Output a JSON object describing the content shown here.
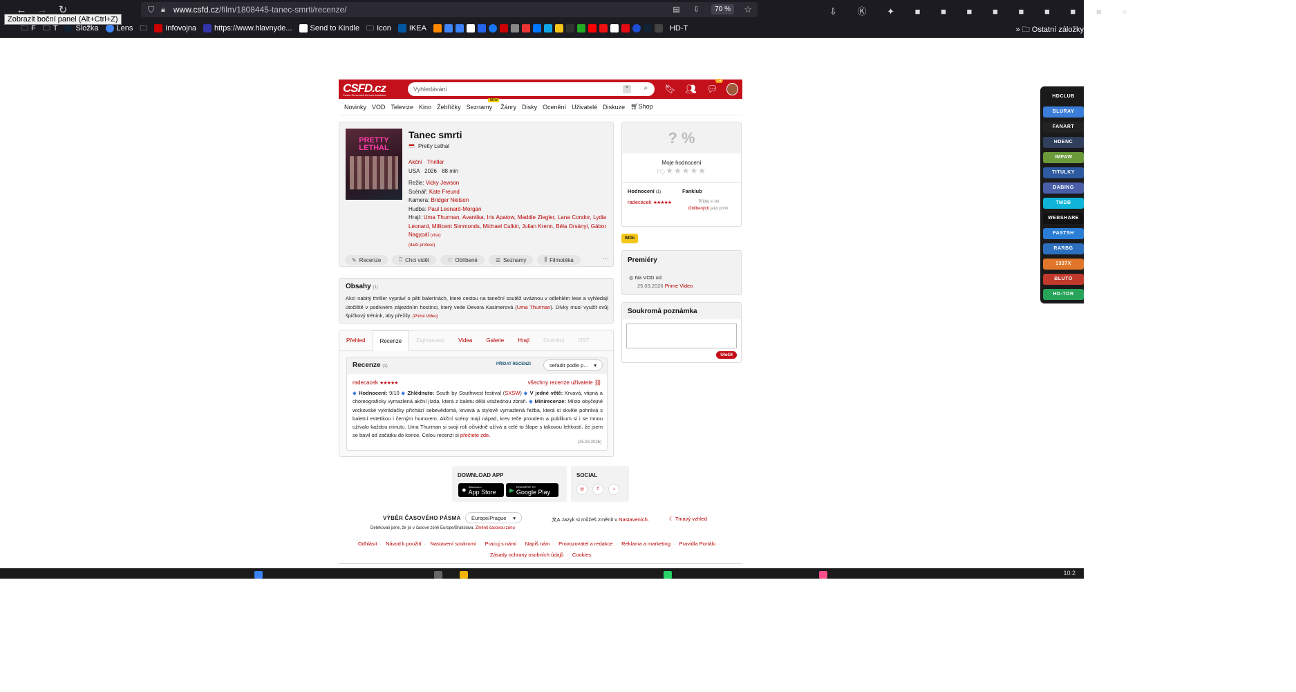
{
  "browser": {
    "url_host": "www.csfd.cz",
    "url_path": "/film/1808445-tanec-smrti/recenze/",
    "zoom": "70 %",
    "tooltip": "Zobrazit boční panel (Alt+Ctrl+Z)",
    "bookmarks": [
      "F",
      "T",
      "Složka",
      "Lens",
      "Infovojna",
      "https://www.hlavnyde...",
      "Send to Kindle",
      "Icon",
      "IKEA",
      "HD-T"
    ],
    "other_bookmarks": "Ostatní záložky"
  },
  "site": {
    "logo": "CSFD.cz",
    "logo_sub": "Česko-Slovenská filmová databáze",
    "search_placeholder": "Vyhledávání",
    "notif_count": "14",
    "menu": [
      "Novinky",
      "VOD",
      "Televize",
      "Kino",
      "Žebříčky",
      "Seznamy",
      "Žánry",
      "Disky",
      "Ocenění",
      "Uživatelé",
      "Diskuze",
      "Shop"
    ],
    "menu_new_badge": "NEW"
  },
  "film": {
    "poster_text": "PRETTY LETHAL",
    "title": "Tanec smrti",
    "original_title": "Pretty Lethal",
    "genres": [
      "Akční",
      "Thriller"
    ],
    "country_year_length": [
      "USA",
      "2026",
      "88 min"
    ],
    "credits": [
      {
        "role": "Režie:",
        "names": "Vicky Jewson"
      },
      {
        "role": "Scénář:",
        "names": "Kate Freund"
      },
      {
        "role": "Kamera:",
        "names": "Bridger Nielson"
      },
      {
        "role": "Hudba:",
        "names": "Paul Leonard-Morgan"
      },
      {
        "role": "Hrají:",
        "names": "Uma Thurman, Avantika, Iris Apatow, Maddie Ziegler, Lana Condor, Lydia Leonard, Millicent Simmonds, Michael Culkin, Julian Krenn, Béla Orsányi, Gábor Nagypál"
      }
    ],
    "more_cast": "(více)",
    "more_professions": "(další profese)",
    "actions": [
      "Recenze",
      "Chci vidět",
      "Oblíbené",
      "Seznamy",
      "Filmotéka"
    ]
  },
  "plot": {
    "heading": "Obsahy",
    "count": "(1)",
    "text_1": "Akcí nabitý thriller vypráví o pěti balerínách, které cestou na taneční soutěž uváznou v odlehlém lese a vyhledají útočiště v podivném zájezdním hostinci, který vede Devora Kasimerová (",
    "text_link": "Uma Thurman",
    "text_2": "). Dívky musí využít svůj špičkový trénink, aby přežily.",
    "source": "(Prime Video)"
  },
  "tabs": [
    {
      "label": "Přehled",
      "state": "link"
    },
    {
      "label": "Recenze",
      "state": "active"
    },
    {
      "label": "Zajímavosti",
      "state": "disabled"
    },
    {
      "label": "Videa",
      "state": "link"
    },
    {
      "label": "Galerie",
      "state": "link"
    },
    {
      "label": "Hrají",
      "state": "link"
    },
    {
      "label": "Ocenění",
      "state": "disabled"
    },
    {
      "label": "OST",
      "state": "disabled"
    }
  ],
  "reviews": {
    "heading": "Recenze",
    "count": "(1)",
    "add_label": "PŘIDAT RECENZI",
    "sort_label": "seřadit podle p...",
    "user": "radecacek",
    "stars": "★★★★★",
    "all_by_user": "všechny recenze uživatele",
    "text_lead_a": "Hodnocení:",
    "text_lead_a_val": " 9/10 ",
    "text_lead_b": "Zhlédnuto:",
    "text_lead_b_val": " South by Southwest festival (",
    "text_sxsw": "SXSW",
    "text_after_sxsw": ") ",
    "text_lead_c": "V jedné větě:",
    "text_c": " Krvavá, vtipná a choreograficky vymazlená akční jízda, která z baletu dělá vražednou zbraň. ",
    "text_lead_d": "Minirecenze:",
    "text_d": " Místo obyčejné wickovské vykrádačky přichází sebevědomá, krvavá a stylově vymazlená řežba, která si skvěle pohrává s baletní estetikou i černým humorem. Akční scény mají nápad, krev teče proudem a publikum si i se mnou užívalo každou minutu. Uma Thurman si svoji roli očividně užívá a celé to šlape s takovou lehkostí, že jsem se bavil od začátku do konce. Celou recenzi si ",
    "text_link": "přečtete zde",
    "text_end": ".",
    "date": "(25.03.2026)"
  },
  "rating": {
    "percent": "? %",
    "my_rating": "Moje hodnocení",
    "ratings_label": "Hodnocení",
    "ratings_count": "(1)",
    "rater": "radecacek",
    "rater_stars": "★★★★★",
    "fanclub": "Fanklub",
    "fanclub_text_1": "Přidej si do",
    "fanclub_link": "Oblíbených",
    "fanclub_text_2": "jako prvni."
  },
  "imdb": "IMDb",
  "premieres": {
    "heading": "Premiéry",
    "label": "Na VOD od",
    "date": "25.03.2026",
    "platform": "Prime Video"
  },
  "note": {
    "heading": "Soukromá poznámka",
    "save": "Uložit"
  },
  "footer": {
    "download_heading": "DOWNLOAD APP",
    "appstore_small": "Stáhnout v",
    "appstore": "App Store",
    "gplay_small": "ROZJEĎTE TO",
    "gplay": "Google Play",
    "social_heading": "SOCIAL",
    "tz_heading": "VÝBĚR ČASOVÉHO PÁSMA",
    "tz_value": "Europe/Prague",
    "lang_text": "Jazyk si můžeš změnit v",
    "lang_link": "Nastaveních.",
    "dark_mode": "Tmavý vzhled",
    "tz_info": "Detekovali jsme, že jsi v časové zóně Europe/Bratislava.",
    "tz_change": "Změnit časovou zónu",
    "links_row1": [
      "Odhlásit",
      "Návod k použití",
      "Nastavení soukromí",
      "Pracuj s námi",
      "Napiš nám",
      "Provozovatel a redakce",
      "Reklama a marketing",
      "Pravidla Portálu"
    ],
    "links_row2": [
      "Zásady ochrany osobních údajů",
      "Cookies"
    ]
  },
  "side_panel": [
    {
      "label": "HDCLUB",
      "color": "#1a1a1a"
    },
    {
      "label": "BLURAY",
      "color": "#3b7dd8"
    },
    {
      "label": "FANART",
      "color": "#222222"
    },
    {
      "label": "HDENC",
      "color": "#2f3f5c"
    },
    {
      "label": "IMPAW",
      "color": "#6a9a3a"
    },
    {
      "label": "TITULKY",
      "color": "#2d5aa0"
    },
    {
      "label": "DABING",
      "color": "#4a5fa8"
    },
    {
      "label": "TMDB",
      "color": "#0fb5d8"
    },
    {
      "label": "WEBSHARE",
      "color": "#111111"
    },
    {
      "label": "FASTSH",
      "color": "#2b7ed6"
    },
    {
      "label": "RARBG",
      "color": "#2d6fbf"
    },
    {
      "label": "1337X",
      "color": "#e0762a"
    },
    {
      "label": "BLUTO",
      "color": "#c0392b"
    },
    {
      "label": "HD-TOR",
      "color": "#27a35a"
    }
  ],
  "clock": "10:2"
}
